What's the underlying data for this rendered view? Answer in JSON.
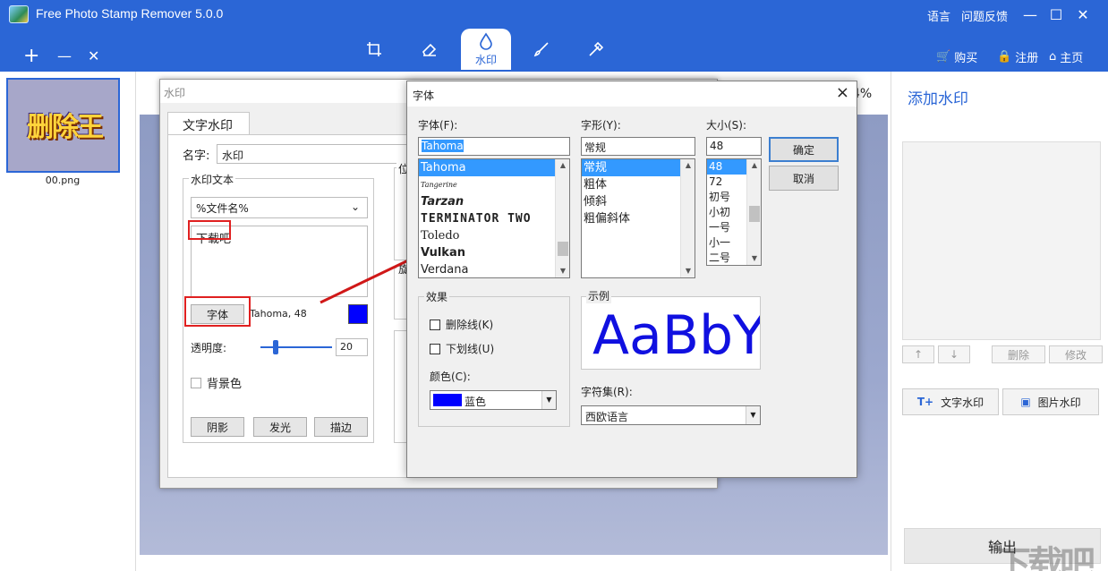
{
  "app": {
    "title": "Free Photo Stamp Remover 5.0.0",
    "lang_link": "语言",
    "feedback_link": "问题反馈",
    "win_min": "—",
    "win_max": "☐",
    "win_close": "✕",
    "add": "+",
    "remove": "—",
    "clear": "✕"
  },
  "tools": {
    "active_label": "水印"
  },
  "account": {
    "buy": "购买",
    "register": "注册",
    "home": "主页"
  },
  "thumbnails": [
    {
      "name": "00.png",
      "art": "删除王"
    }
  ],
  "canvas": {
    "zoom": "4%"
  },
  "right_panel": {
    "title": "添加水印",
    "up": "↑",
    "down": "↓",
    "delete": "删除",
    "modify": "修改",
    "text_wm": "文字水印",
    "image_wm": "图片水印",
    "output": "输出"
  },
  "wm_dialog": {
    "title": "水印",
    "tab": "文字水印",
    "name_label": "名字:",
    "name_value": "水印",
    "text_group": "水印文本",
    "text_select": "%文件名%",
    "text_content": "下载吧",
    "font_button": "字体",
    "font_desc": "Tahoma, 48",
    "opacity_label": "透明度:",
    "opacity_value": "20",
    "opacity_fraction": 0.2,
    "bg_label": "背景色",
    "shadow": "阴影",
    "glow": "发光",
    "stroke": "描边",
    "partial1": "位",
    "partial2": "旋",
    "color": "#0000ff"
  },
  "font_dialog": {
    "title": "字体",
    "font_label": "字体(F):",
    "font_value": "Tahoma",
    "fonts": [
      "Tahoma",
      "Tangerine",
      "Tarzan",
      "TERMINATOR TWO",
      "Toledo",
      "Vulkan",
      "Verdana"
    ],
    "style_label": "字形(Y):",
    "style_value": "常规",
    "styles": [
      "常规",
      "粗体",
      "倾斜",
      "粗偏斜体"
    ],
    "size_label": "大小(S):",
    "size_value": "48",
    "sizes": [
      "48",
      "72",
      "初号",
      "小初",
      "一号",
      "小一",
      "二号"
    ],
    "ok": "确定",
    "cancel": "取消",
    "effects_label": "效果",
    "strike": "删除线(K)",
    "underline": "下划线(U)",
    "color_label": "颜色(C):",
    "color_value": "蓝色",
    "color_hex": "#0000ff",
    "sample_label": "示例",
    "sample_text": "AaBbYyZz",
    "charset_label": "字符集(R):",
    "charset_value": "西欧语言"
  },
  "brand": {
    "watermark": "下载吧"
  }
}
